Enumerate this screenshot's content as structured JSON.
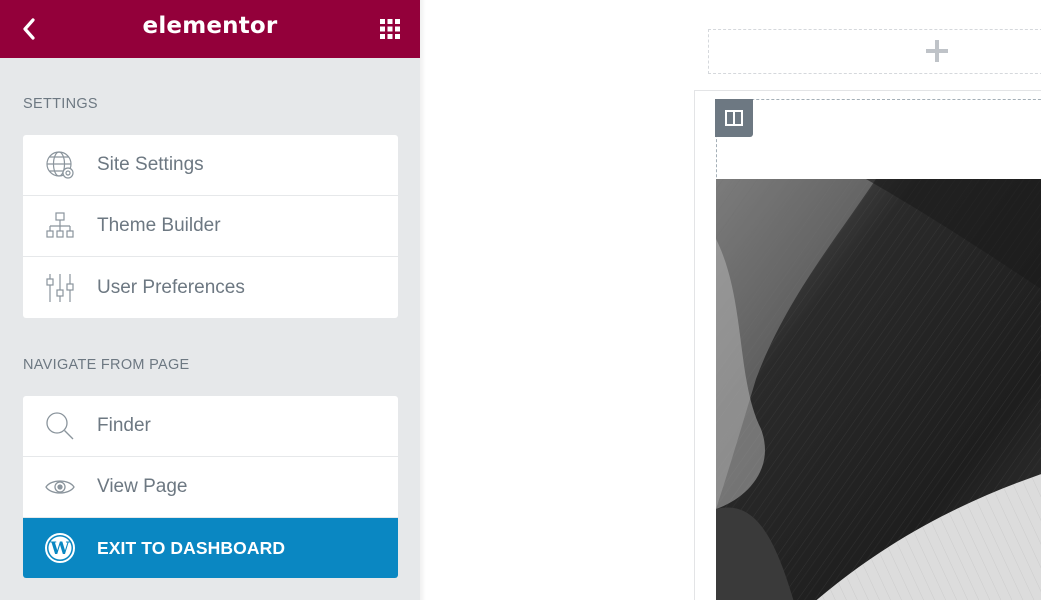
{
  "header": {
    "logo": "elementor"
  },
  "settings": {
    "title": "SETTINGS",
    "items": [
      {
        "label": "Site Settings",
        "icon": "globe-settings-icon"
      },
      {
        "label": "Theme Builder",
        "icon": "sitemap-icon"
      },
      {
        "label": "User Preferences",
        "icon": "sliders-icon"
      }
    ]
  },
  "navigate": {
    "title": "NAVIGATE FROM PAGE",
    "items": [
      {
        "label": "Finder",
        "icon": "search-icon"
      },
      {
        "label": "View Page",
        "icon": "eye-icon"
      },
      {
        "label": "EXIT TO DASHBOARD",
        "icon": "wordpress-icon"
      }
    ]
  },
  "colors": {
    "header_bg": "#93003a",
    "sidebar_bg": "#e6e8ea",
    "exit_bg": "#0a87c2",
    "text_muted": "#6d7882"
  }
}
